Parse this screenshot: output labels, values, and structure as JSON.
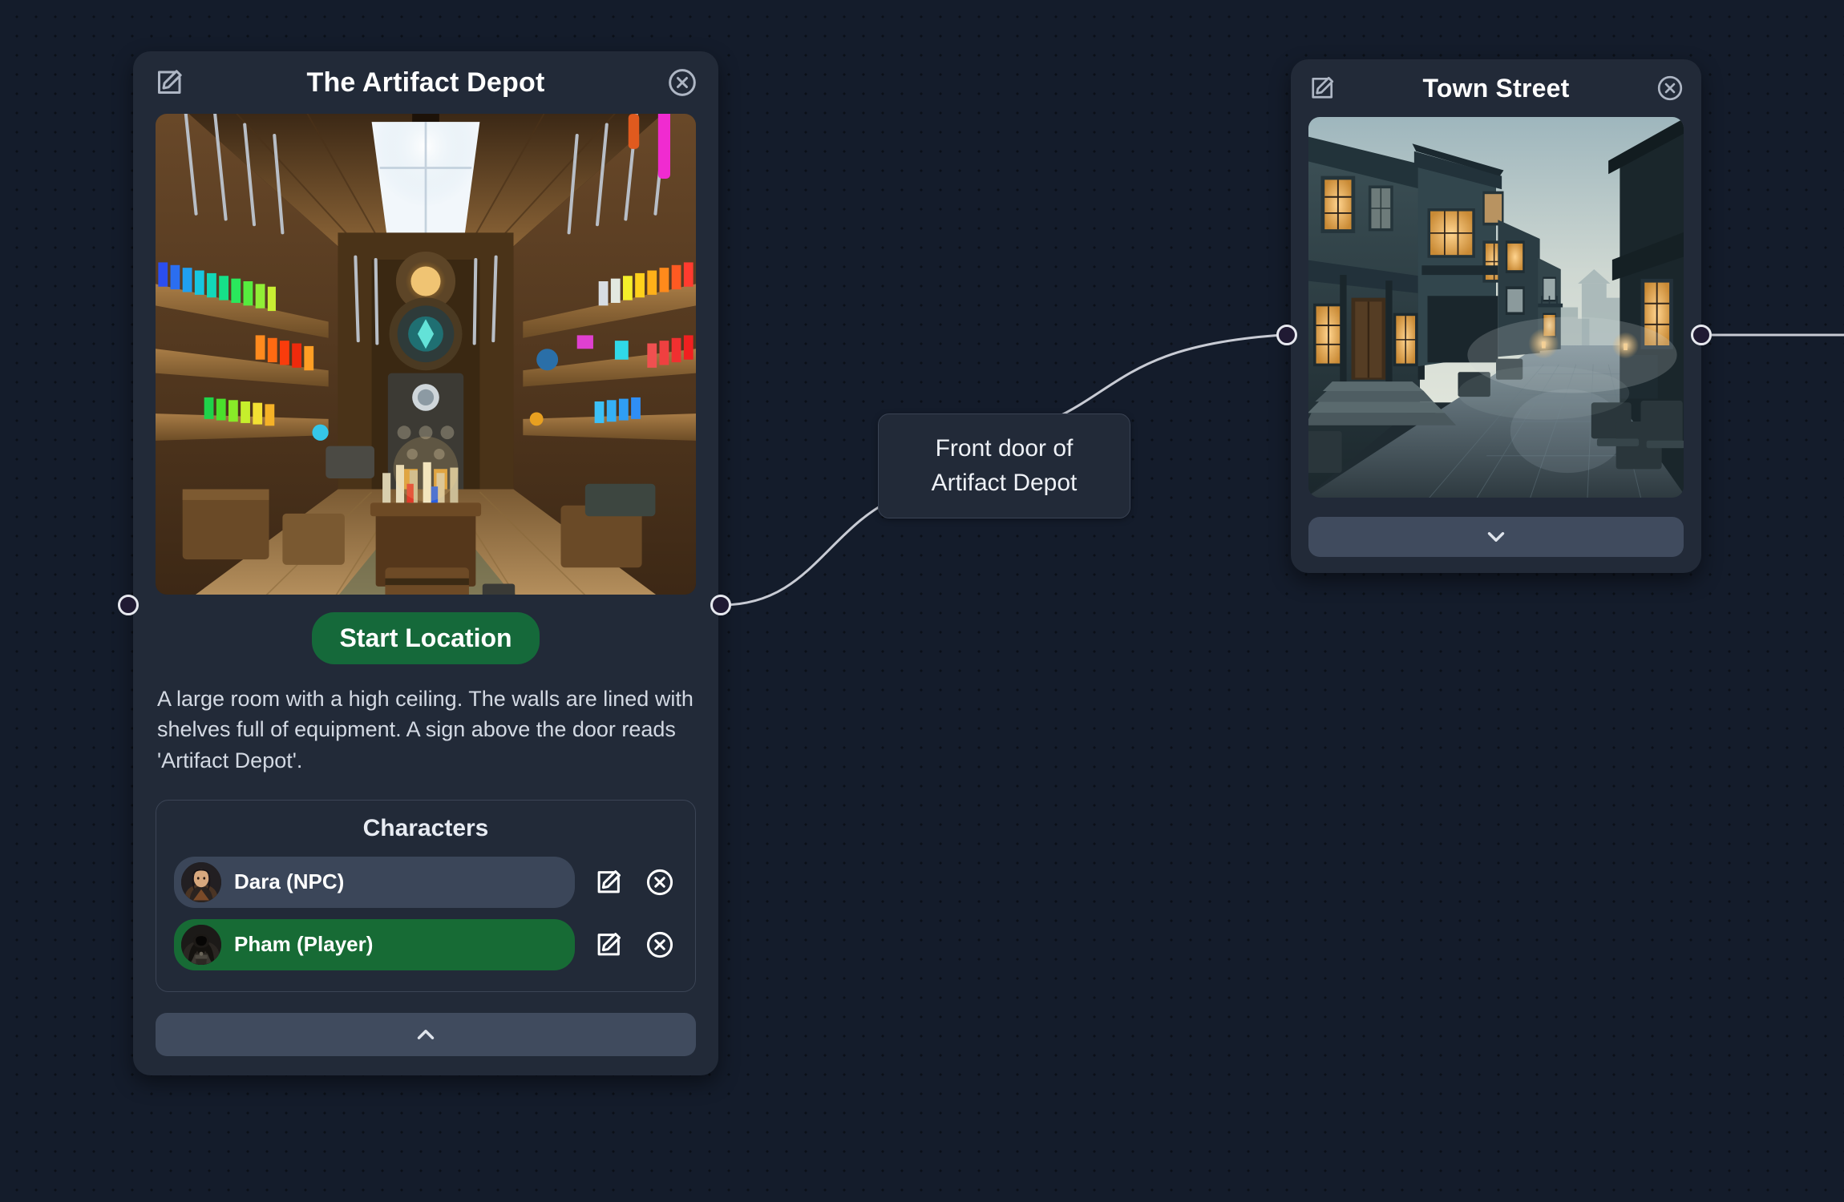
{
  "canvas": {
    "background_color": "#141c2b",
    "dot_color": "#0b1018",
    "edge_color": "#c8cbd4"
  },
  "nodes": [
    {
      "id": "artifact-depot",
      "title": "The Artifact Depot",
      "edit_icon": "edit-pencil-square-icon",
      "close_icon": "close-circle-icon",
      "image_alt": "Interior of a fantasy artifact shop with wooden shelves of colorful potions, weapons on the walls, a skylight, a glowing arcane door and a central counter",
      "start_badge": "Start Location",
      "description": "A large room with a high ceiling. The walls are lined with shelves full of equipment. A sign above the door reads 'Artifact Depot'.",
      "characters_title": "Characters",
      "characters": [
        {
          "name": "Dara (NPC)",
          "role": "NPC",
          "chip_color": "#3b4659",
          "avatar_alt": "Dark-haired woman in leather armour portrait",
          "edit_icon": "edit-pencil-square-icon",
          "remove_icon": "close-circle-icon"
        },
        {
          "name": "Pham (Player)",
          "role": "Player",
          "chip_color": "#176b35",
          "avatar_alt": "Hooded figure in dark robes portrait",
          "edit_icon": "edit-pencil-square-icon",
          "remove_icon": "close-circle-icon"
        }
      ],
      "toggle_icon": "chevron-up-icon",
      "toggle_state": "expanded"
    },
    {
      "id": "town-street",
      "title": "Town Street",
      "edit_icon": "edit-pencil-square-icon",
      "close_icon": "close-circle-icon",
      "image_alt": "Misty cobblestone street at dusk lined with weathered wooden timber-framed houses with glowing windows",
      "toggle_icon": "chevron-down-icon",
      "toggle_state": "collapsed"
    }
  ],
  "edges": [
    {
      "id": "edge-artifact-to-town",
      "label": "Front door of\nArtifact Depot",
      "from": "artifact-depot",
      "to": "town-street"
    },
    {
      "id": "edge-town-right",
      "label": "",
      "from": "town-street",
      "to": ""
    }
  ],
  "handles": [
    {
      "name": "handle-artifact-left"
    },
    {
      "name": "handle-artifact-right"
    },
    {
      "name": "handle-town-left"
    },
    {
      "name": "handle-town-right"
    }
  ]
}
